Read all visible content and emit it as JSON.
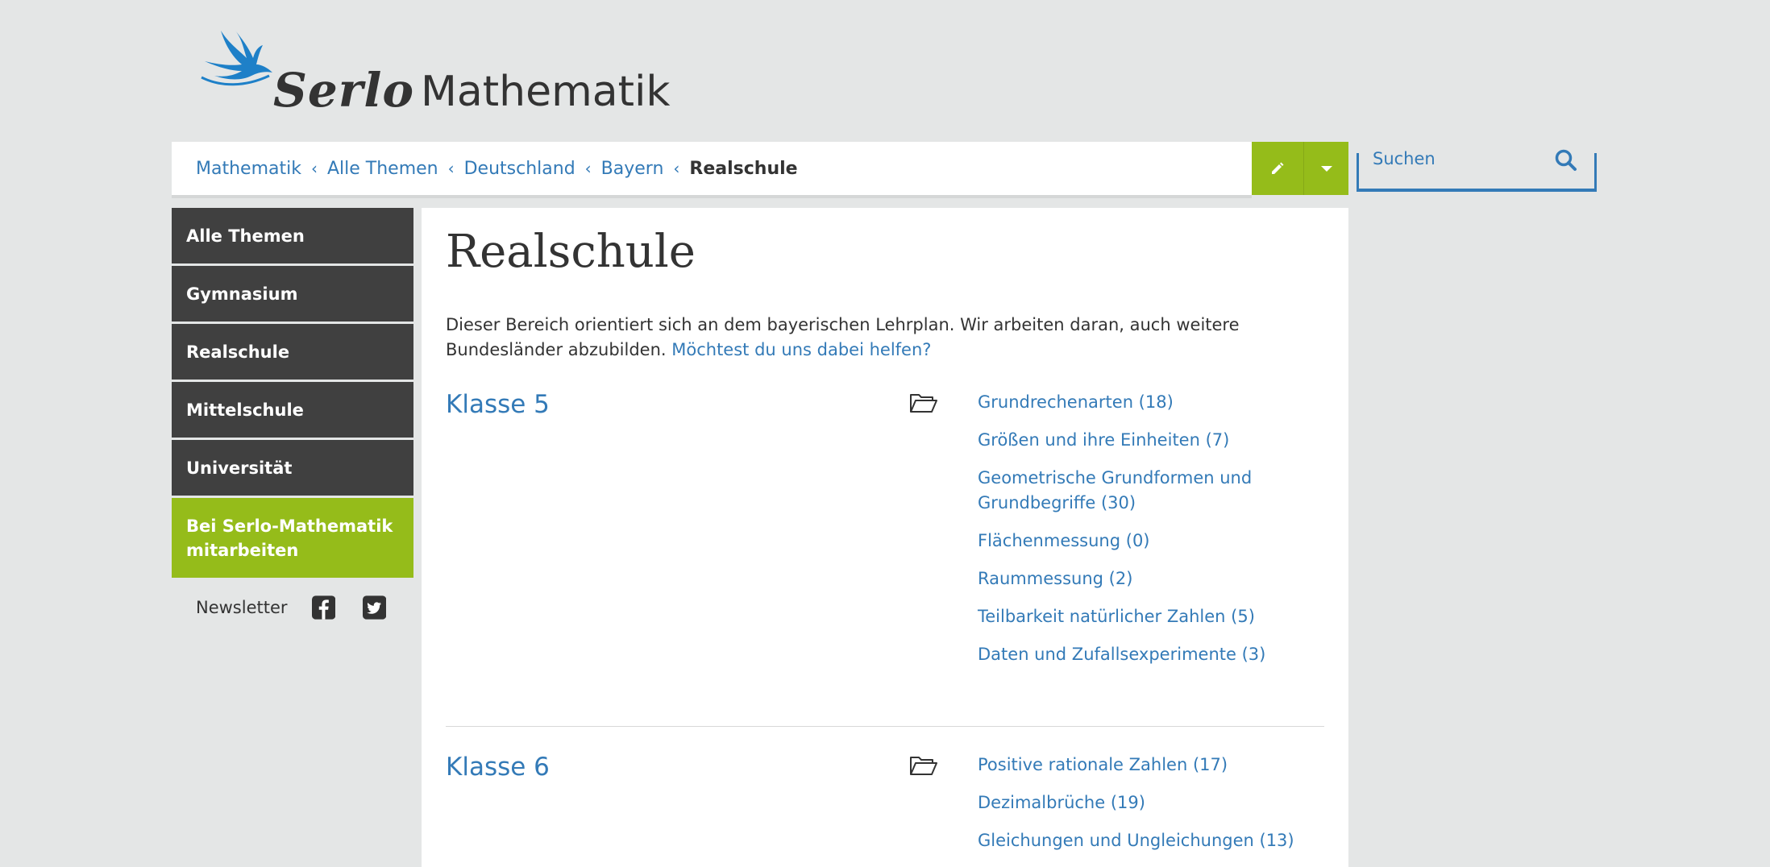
{
  "brand": {
    "name": "Serlo",
    "subject": "Mathematik"
  },
  "breadcrumb": {
    "items": [
      "Mathematik",
      "Alle Themen",
      "Deutschland",
      "Bayern"
    ],
    "current": "Realschule"
  },
  "search": {
    "placeholder": "Suchen"
  },
  "sidebar": {
    "items": [
      {
        "label": "Alle Themen"
      },
      {
        "label": "Gymnasium"
      },
      {
        "label": "Realschule"
      },
      {
        "label": "Mittelschule"
      },
      {
        "label": "Universität"
      }
    ],
    "cta": "Bei Serlo-Mathematik mitarbeiten",
    "newsletter": "Newsletter"
  },
  "main": {
    "title": "Realschule",
    "intro": "Dieser Bereich orientiert sich an dem bayerischen Lehrplan. Wir arbeiten daran, auch weitere Bundesländer abzubilden.",
    "intro_link": "Möchtest du uns dabei helfen?",
    "sections": [
      {
        "title": "Klasse 5",
        "topics": [
          "Grundrechenarten (18)",
          "Größen und ihre Einheiten (7)",
          "Geometrische Grundformen und Grundbegriffe (30)",
          "Flächenmessung (0)",
          "Raummessung (2)",
          "Teilbarkeit natürlicher Zahlen (5)",
          "Daten und Zufallsexperimente (3)"
        ]
      },
      {
        "title": "Klasse 6",
        "topics": [
          "Positive rationale Zahlen (17)",
          "Dezimalbrüche (19)",
          "Gleichungen und Ungleichungen (13)"
        ]
      }
    ]
  },
  "colors": {
    "accent": "#95bc1a",
    "link": "#337ab7",
    "sidebar": "#404040",
    "background": "#e4e6e6"
  }
}
